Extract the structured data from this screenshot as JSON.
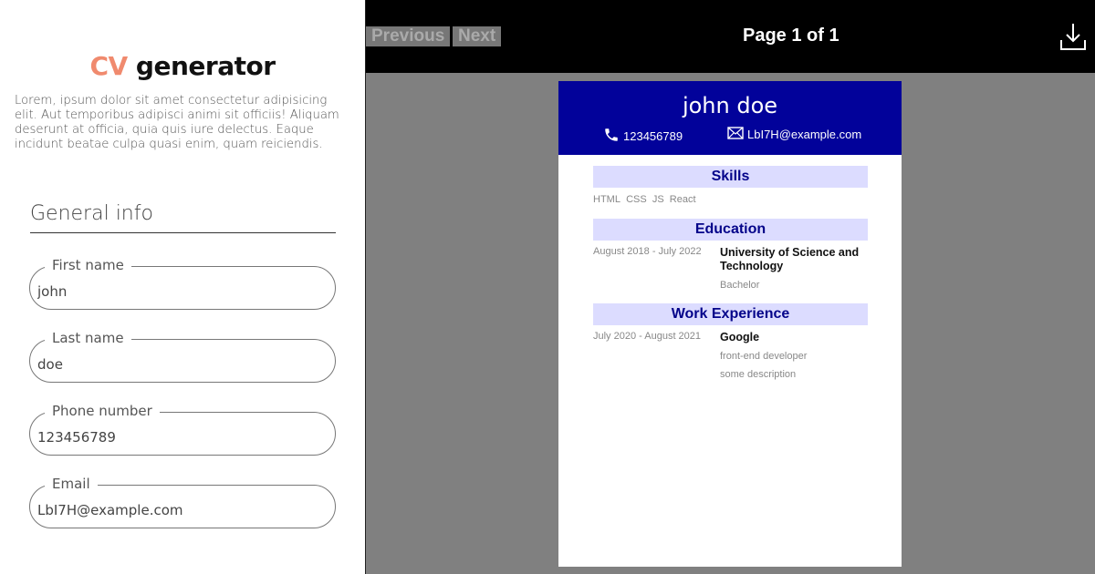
{
  "app": {
    "title_accent": "CV",
    "title_rest": " generator",
    "intro": "Lorem, ipsum dolor sit amet consectetur adipisicing elit. Aut temporibus adipisci animi sit officiis! Aliquam deserunt at officia, quia quis iure delectus. Eaque incidunt beatae culpa quasi enim, quam reiciendis."
  },
  "form": {
    "section_title": "General info",
    "fields": [
      {
        "label": "First name",
        "value": "john"
      },
      {
        "label": "Last name",
        "value": "doe"
      },
      {
        "label": "Phone number",
        "value": "123456789"
      },
      {
        "label": "Email",
        "value": "LbI7H@example.com"
      }
    ]
  },
  "viewer": {
    "prev_label": "Previous",
    "next_label": "Next",
    "page_indicator": "Page 1 of 1",
    "download_icon": "download-icon"
  },
  "cv": {
    "name": "john doe",
    "phone": "123456789",
    "email": "LbI7H@example.com",
    "header_color": "#02029a",
    "section_bar_color": "#dcdcff",
    "skills": {
      "title": "Skills",
      "items": [
        "HTML",
        "CSS",
        "JS",
        "React"
      ]
    },
    "education": {
      "title": "Education",
      "dates": "August 2018 - July 2022",
      "institution": "University of Science and Technology",
      "degree": "Bachelor"
    },
    "work": {
      "title": "Work Experience",
      "dates": "July 2020 - August 2021",
      "company": "Google",
      "position": "front-end developer",
      "description": "some description"
    }
  }
}
